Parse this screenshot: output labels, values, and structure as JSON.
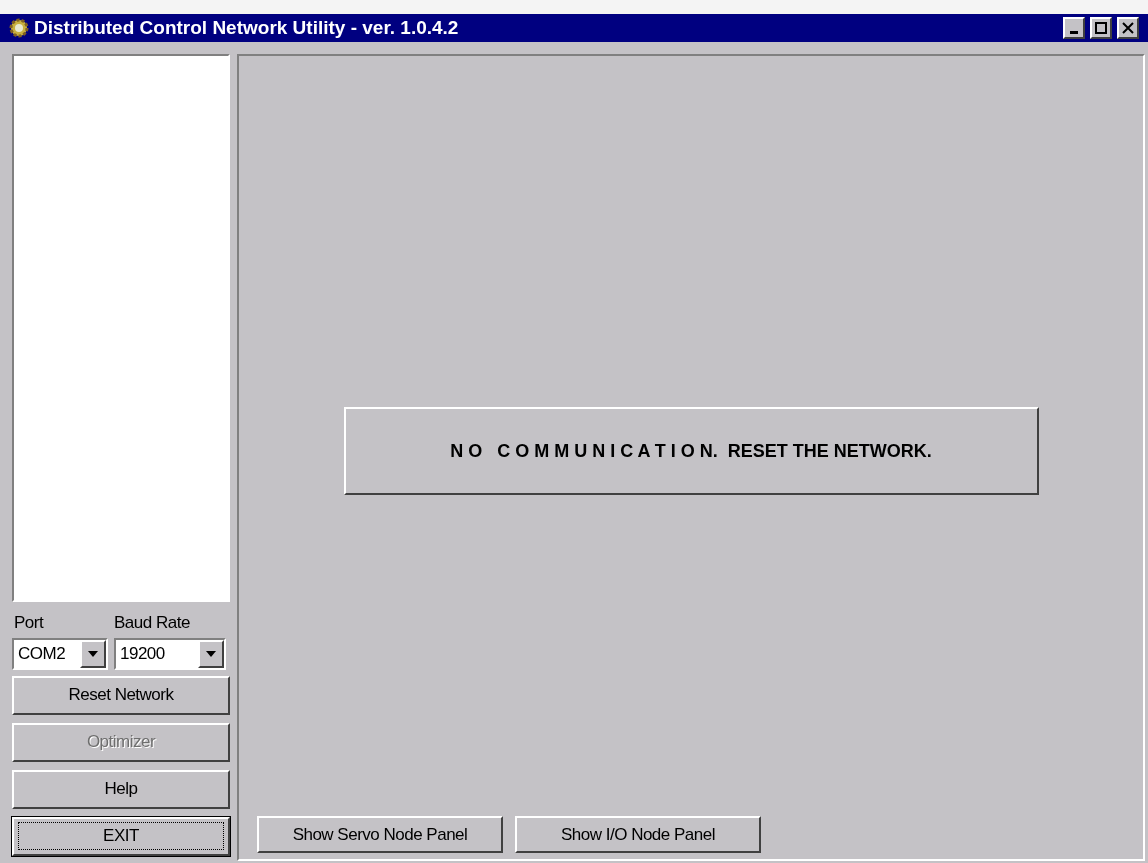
{
  "window": {
    "title": "Distributed Control Network Utility - ver. 1.0.4.2"
  },
  "port": {
    "label": "Port",
    "value": "COM2"
  },
  "baud_rate": {
    "label": "Baud Rate",
    "value": "19200"
  },
  "side_buttons": [
    {
      "label": "Reset Network",
      "disabled": false,
      "focused": false
    },
    {
      "label": "Optimizer",
      "disabled": true,
      "focused": false
    },
    {
      "label": "Help",
      "disabled": false,
      "focused": false
    },
    {
      "label": "EXIT",
      "disabled": false,
      "focused": true
    }
  ],
  "status_message": {
    "spaced": "N O   C O M M U N I C A T I O N.",
    "rest": "RESET THE NETWORK."
  },
  "bottom_buttons": [
    "Show Servo Node Panel",
    "Show I/O Node Panel"
  ]
}
